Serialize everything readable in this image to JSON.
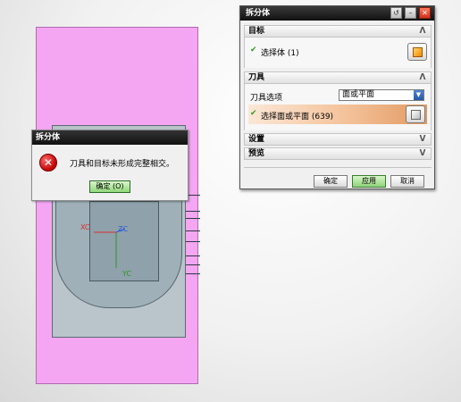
{
  "viewport": {
    "axes": {
      "xc": "XC",
      "zc": "ZC",
      "yc": "YC"
    }
  },
  "message_box": {
    "title": "拆分体",
    "message": "刀具和目标未形成完整相交。",
    "ok_label": "确定 (O)"
  },
  "dialog": {
    "title": "拆分体",
    "controls": {
      "restore": "↺",
      "minimize": "–",
      "close": "✕"
    },
    "sections": {
      "target": {
        "label": "目标",
        "select_body_label": "选择体 (1)"
      },
      "tool": {
        "label": "刀具",
        "tool_option_label": "刀具选项",
        "tool_option_value": "面或平面",
        "select_face_label": "选择面或平面 (639)"
      },
      "settings": {
        "label": "设置"
      },
      "preview": {
        "label": "预览"
      }
    },
    "buttons": {
      "ok": "确定",
      "apply": "应用",
      "cancel": "取消"
    }
  },
  "colors": {
    "pink_body": "#f4a6f3",
    "check_green": "#2f9c23",
    "title_bar": "#111111",
    "selected_row": "#e29a63"
  }
}
